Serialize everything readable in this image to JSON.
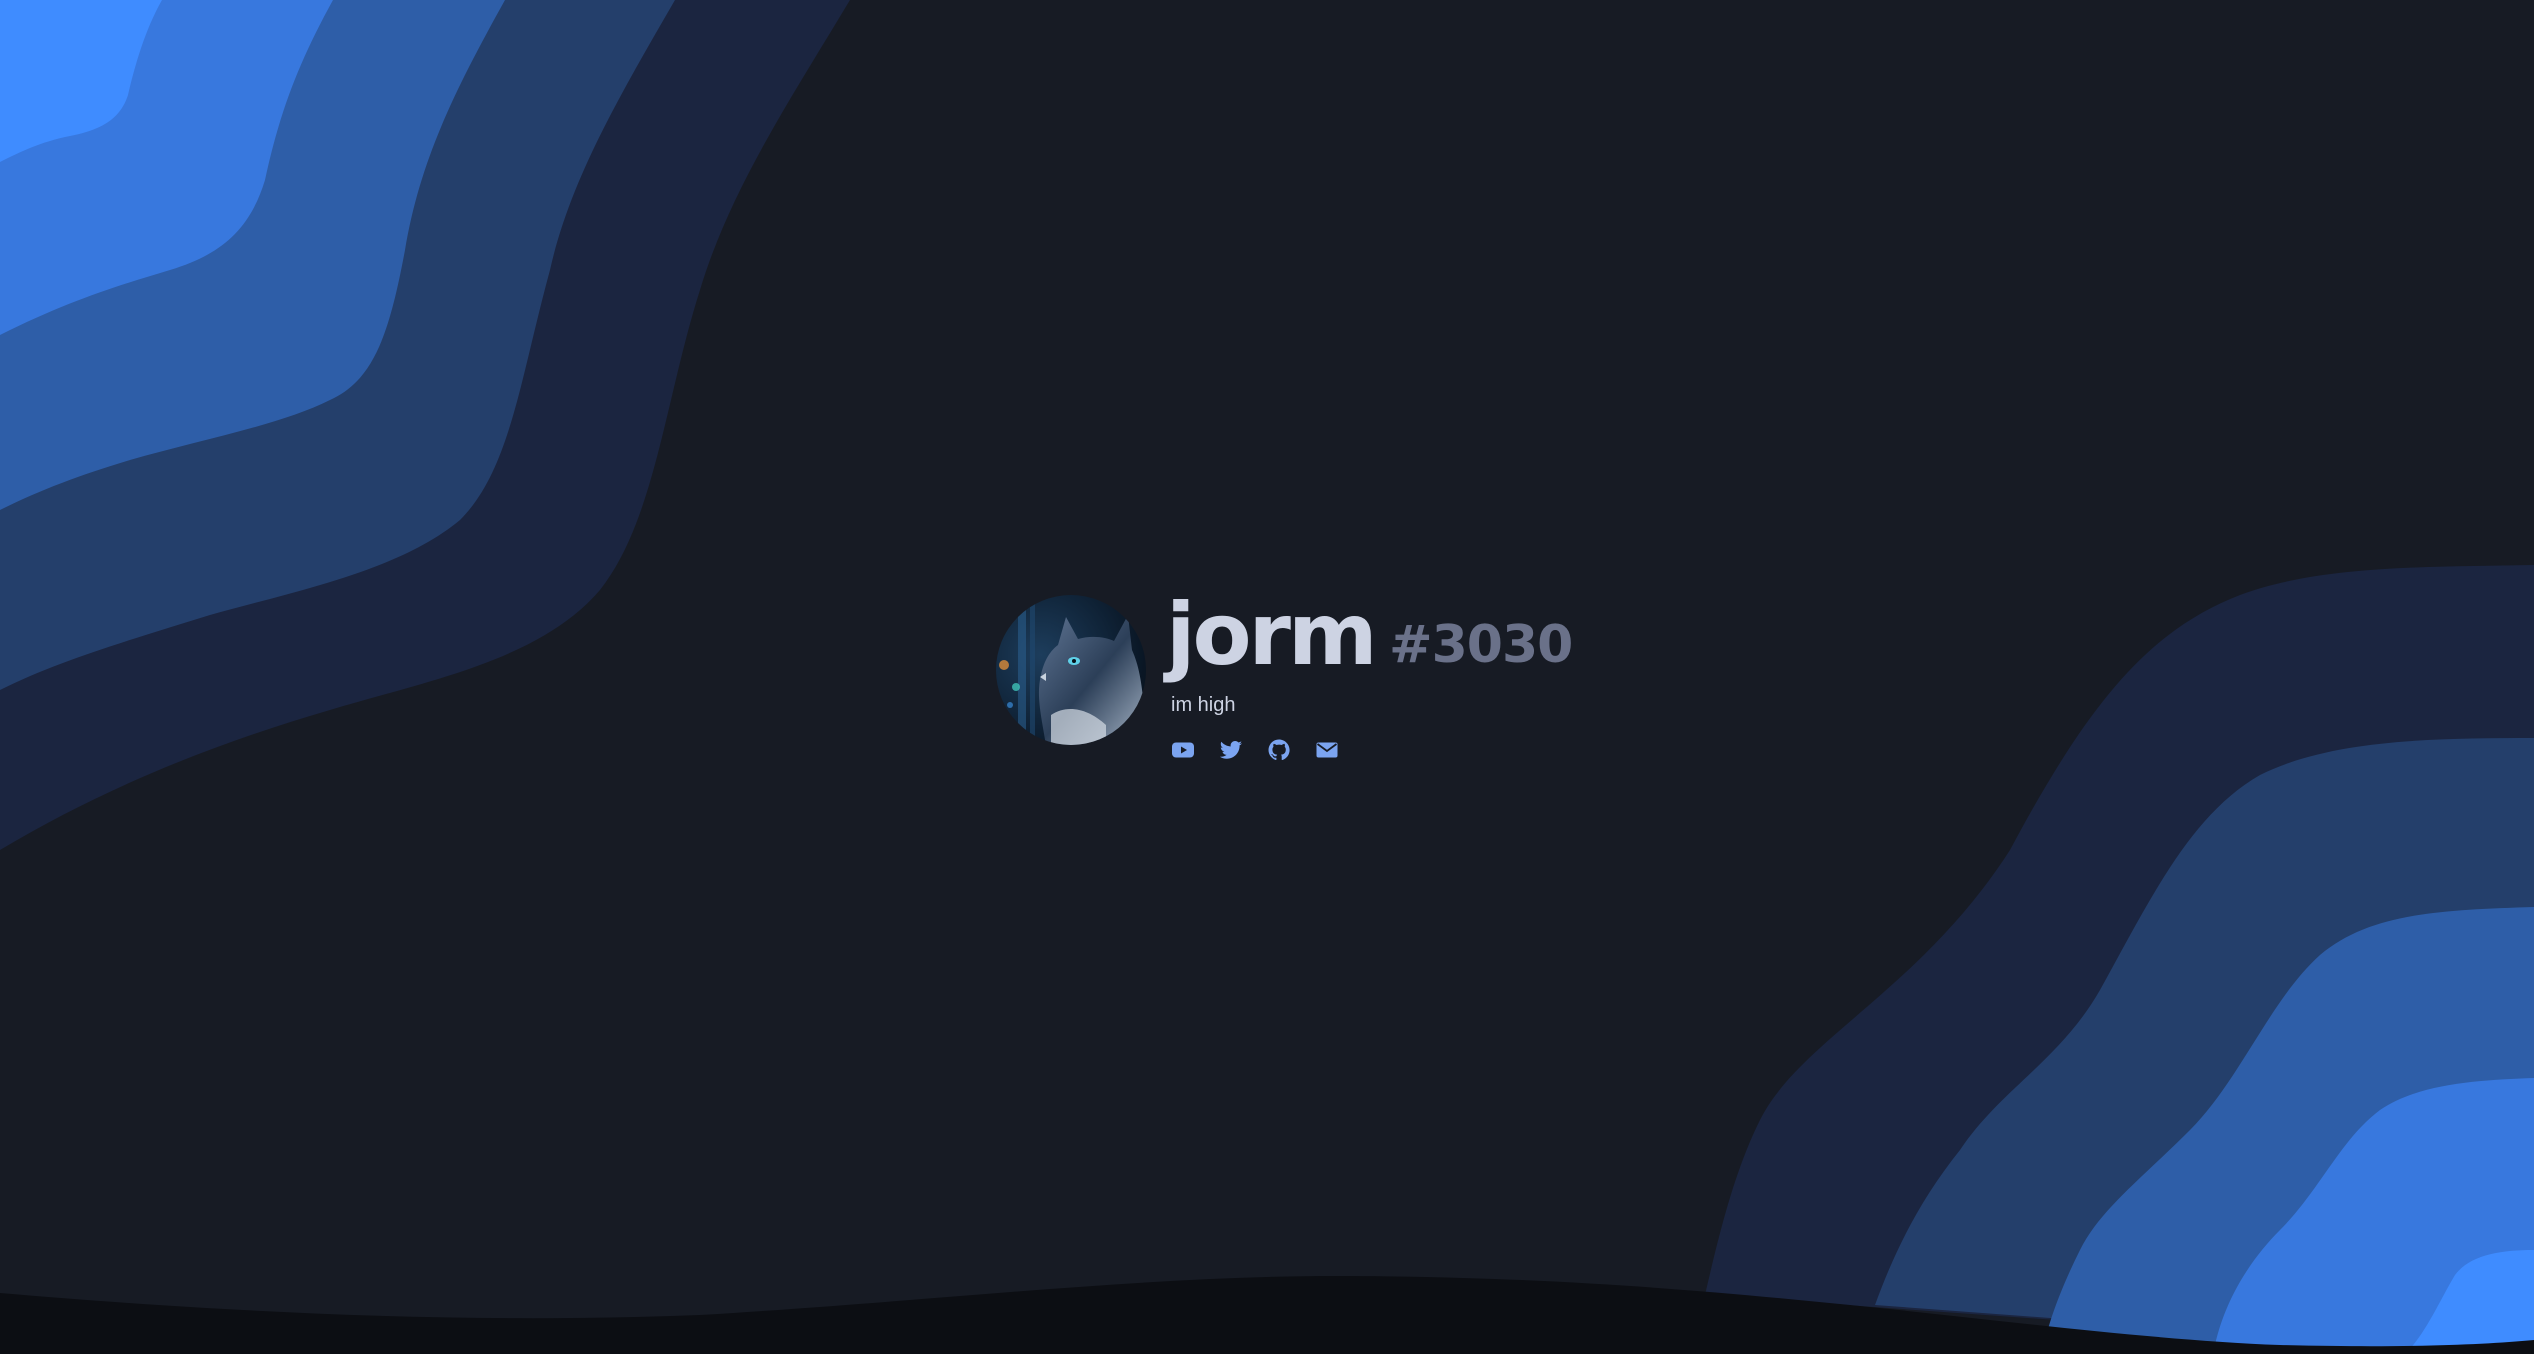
{
  "profile": {
    "username": "jorm",
    "discriminator": "#3030",
    "bio": "im high",
    "avatar_icon": "cat-portrait-avatar"
  },
  "socials": [
    {
      "icon": "youtube-icon"
    },
    {
      "icon": "twitter-icon"
    },
    {
      "icon": "github-icon"
    },
    {
      "icon": "email-icon"
    }
  ],
  "colors": {
    "background": "#171b24",
    "footer": "#0c0e13",
    "wave_1": "#3f8cff",
    "wave_2": "#3878de",
    "wave_3": "#2e5ea8",
    "wave_4": "#243f6b",
    "wave_5": "#1b2540",
    "username": "#cdd3e3",
    "discriminator": "#6a7189",
    "social_icon": "#7ba4f0"
  }
}
